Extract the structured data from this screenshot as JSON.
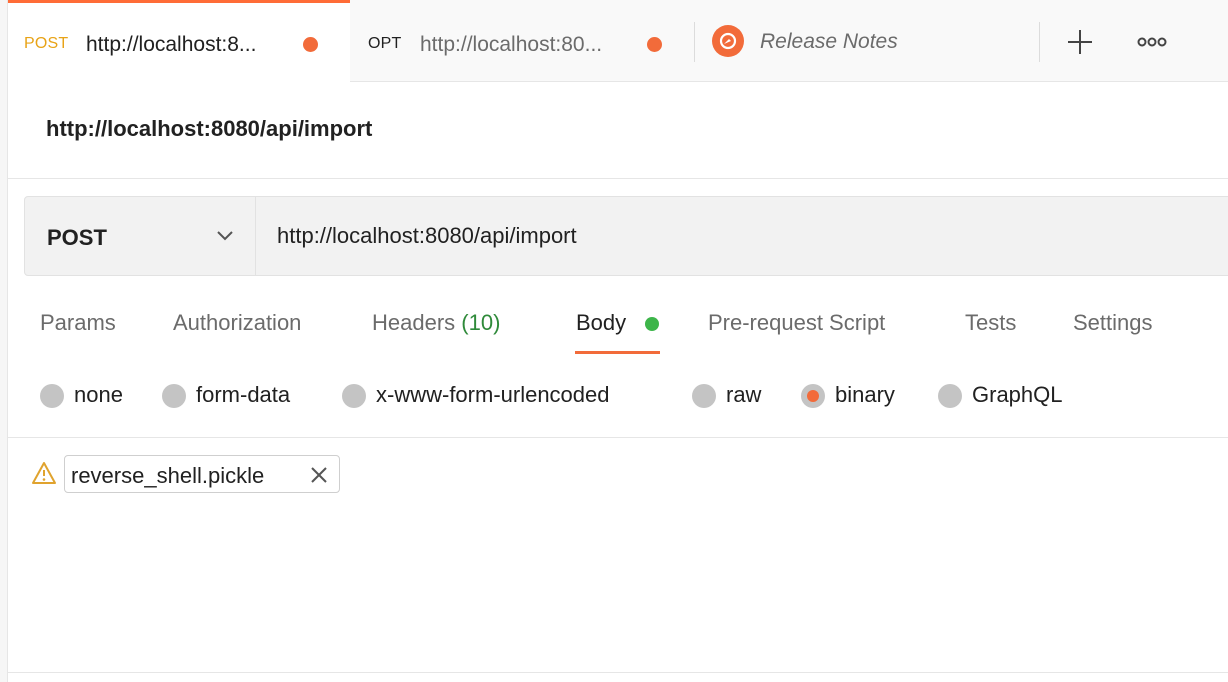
{
  "tabs": [
    {
      "method": "POST",
      "url": "http://localhost:8...",
      "method_color": "#e8a317",
      "unsaved": true
    },
    {
      "method": "OPT",
      "url": "http://localhost:80...",
      "method_color": "#212121",
      "unsaved": true
    },
    {
      "label": "Release Notes",
      "icon": "postman-logo-icon"
    }
  ],
  "tabbar": {
    "add_icon": "plus-icon",
    "more_icon": "more-horizontal-icon"
  },
  "request": {
    "title": "http://localhost:8080/api/import",
    "method": "POST",
    "url": "http://localhost:8080/api/import"
  },
  "subtabs": {
    "params": "Params",
    "authorization": "Authorization",
    "headers": "Headers",
    "headers_count": "(10)",
    "body": "Body",
    "prerequest": "Pre-request Script",
    "tests": "Tests",
    "settings": "Settings",
    "active": "Body"
  },
  "body_types": {
    "none": "none",
    "form_data": "form-data",
    "urlencoded": "x-www-form-urlencoded",
    "raw": "raw",
    "binary": "binary",
    "graphql": "GraphQL",
    "selected": "binary"
  },
  "file": {
    "name": "reverse_shell.pickle",
    "warning_icon": "warning-icon",
    "remove_icon": "close-icon"
  },
  "colors": {
    "accent": "#f26b3a",
    "body_indicator": "#3db54a",
    "headers_count": "#2f8a3a"
  }
}
